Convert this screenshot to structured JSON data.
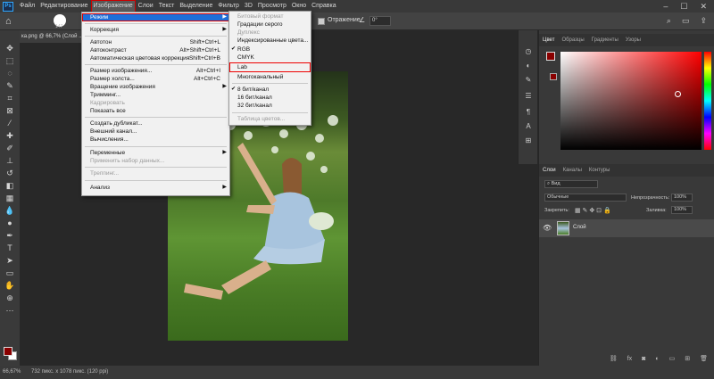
{
  "menubar": {
    "logo": "Ps",
    "items": [
      "Файл",
      "Редактирование",
      "Изображение",
      "Слои",
      "Текст",
      "Выделение",
      "Фильтр",
      "3D",
      "Просмотр",
      "Окно",
      "Справка"
    ],
    "active_index": 2
  },
  "options": {
    "brush_size": "147",
    "mirror_label": "Отражение",
    "angle_value": "0°"
  },
  "document": {
    "tab_title": "ка.png @ 66,7% (Слой ..."
  },
  "image_menu": {
    "items": [
      {
        "label": "Режим",
        "shortcut": "",
        "submenu": true,
        "state": "highlighted"
      },
      {
        "label": "Коррекция",
        "shortcut": "",
        "submenu": true,
        "state": "normal"
      },
      {
        "label": "Автотон",
        "shortcut": "Shift+Ctrl+L",
        "submenu": false,
        "state": "normal"
      },
      {
        "label": "Автоконтраст",
        "shortcut": "Alt+Shift+Ctrl+L",
        "submenu": false,
        "state": "normal"
      },
      {
        "label": "Автоматическая цветовая коррекция",
        "shortcut": "Shift+Ctrl+B",
        "submenu": false,
        "state": "normal"
      },
      {
        "label": "Размер изображения...",
        "shortcut": "Alt+Ctrl+I",
        "submenu": false,
        "state": "normal"
      },
      {
        "label": "Размер холста...",
        "shortcut": "Alt+Ctrl+C",
        "submenu": false,
        "state": "normal"
      },
      {
        "label": "Вращение изображения",
        "shortcut": "",
        "submenu": true,
        "state": "normal"
      },
      {
        "label": "Тримминг...",
        "shortcut": "",
        "submenu": false,
        "state": "normal"
      },
      {
        "label": "Кадрировать",
        "shortcut": "",
        "submenu": false,
        "state": "disabled"
      },
      {
        "label": "Показать все",
        "shortcut": "",
        "submenu": false,
        "state": "normal"
      },
      {
        "label": "Создать дубликат...",
        "shortcut": "",
        "submenu": false,
        "state": "normal"
      },
      {
        "label": "Внешний канал...",
        "shortcut": "",
        "submenu": false,
        "state": "normal"
      },
      {
        "label": "Вычисления...",
        "shortcut": "",
        "submenu": false,
        "state": "normal"
      },
      {
        "label": "Переменные",
        "shortcut": "",
        "submenu": true,
        "state": "normal"
      },
      {
        "label": "Применить набор данных...",
        "shortcut": "",
        "submenu": false,
        "state": "disabled"
      },
      {
        "label": "Треппинг...",
        "shortcut": "",
        "submenu": false,
        "state": "disabled"
      },
      {
        "label": "Анализ",
        "shortcut": "",
        "submenu": true,
        "state": "normal"
      }
    ]
  },
  "mode_submenu": {
    "items": [
      {
        "label": "Битовый формат",
        "state": "disabled",
        "checked": false
      },
      {
        "label": "Градации серого",
        "state": "normal",
        "checked": false
      },
      {
        "label": "Дуплекс",
        "state": "disabled",
        "checked": false
      },
      {
        "label": "Индексированные цвета...",
        "state": "normal",
        "checked": false
      },
      {
        "label": "RGB",
        "state": "normal",
        "checked": true
      },
      {
        "label": "CMYK",
        "state": "normal",
        "checked": false
      },
      {
        "label": "Lab",
        "state": "boxed",
        "checked": false
      },
      {
        "label": "Многоканальный",
        "state": "normal",
        "checked": false
      },
      {
        "label": "8 бит/канал",
        "state": "normal",
        "checked": true
      },
      {
        "label": "16 бит/канал",
        "state": "normal",
        "checked": false
      },
      {
        "label": "32 бит/канал",
        "state": "normal",
        "checked": false
      },
      {
        "label": "Таблица цветов...",
        "state": "disabled",
        "checked": false
      }
    ]
  },
  "color_panel": {
    "tabs": [
      "Цвет",
      "Образцы",
      "Градиенты",
      "Узоры"
    ],
    "foreground_color": "#8a0000"
  },
  "layers_panel": {
    "tabs": [
      "Слои",
      "Каналы",
      "Контуры"
    ],
    "filter_label": "Вид",
    "blend_mode": "Обычные",
    "opacity_label": "Непрозрачность:",
    "opacity_value": "100%",
    "lock_label": "Закрепить:",
    "fill_label": "Заливка:",
    "fill_value": "100%",
    "layer_name": "Слой"
  },
  "status": {
    "zoom": "66,67%",
    "dims": "732 пикс. х 1078 пикс. (120 ppi)"
  }
}
